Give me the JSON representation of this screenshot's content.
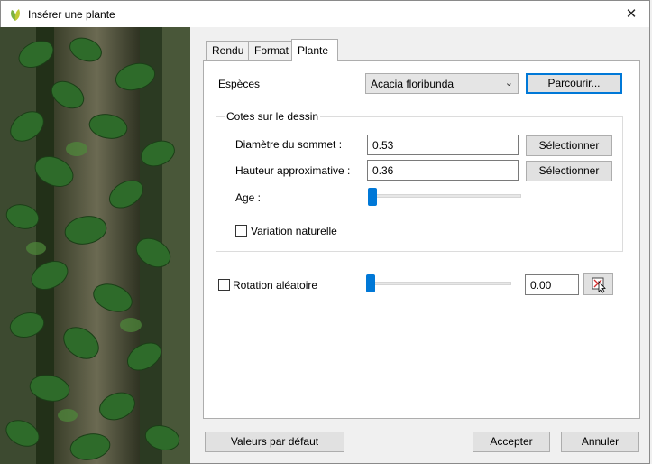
{
  "window": {
    "title": "Insérer une plante",
    "close_glyph": "✕"
  },
  "tabs": [
    {
      "label": "Rendu",
      "active": false
    },
    {
      "label": "Format",
      "active": false
    },
    {
      "label": "Plante",
      "active": true
    }
  ],
  "plante": {
    "especes_label": "Espèces",
    "especes_value": "Acacia floribunda",
    "browse_button": "Parcourir...",
    "group_label": "Cotes sur le dessin",
    "diametre_label": "Diamètre du sommet :",
    "diametre_value": "0.53",
    "hauteur_label": "Hauteur approximative :",
    "hauteur_value": "0.36",
    "select_button": "Sélectionner",
    "age_label": "Age :",
    "age_slider_level": 0.0,
    "variation_label": "Variation naturelle",
    "variation_checked": false,
    "rotation_label": "Rotation aléatoire",
    "rotation_checked": false,
    "rotation_slider_level": 0.0,
    "rotation_value": "0.00"
  },
  "footer": {
    "defaults_button": "Valeurs par défaut",
    "ok_button": "Accepter",
    "cancel_button": "Annuler"
  },
  "colors": {
    "accent": "#0078d7",
    "panel_bg": "#ffffff",
    "dialog_bg": "#f0f0f0"
  }
}
